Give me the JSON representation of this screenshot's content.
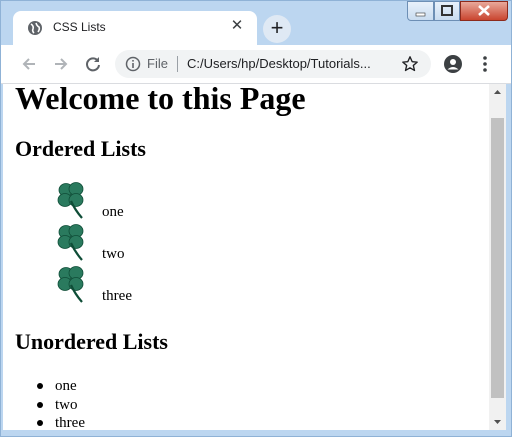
{
  "tab": {
    "title": "CSS Lists"
  },
  "address_bar": {
    "scheme_label": "File",
    "url": "C:/Users/hp/Desktop/Tutorials..."
  },
  "page": {
    "heading": "Welcome to this Page",
    "ordered_heading": "Ordered Lists",
    "ordered_items": [
      "one",
      "two",
      "three"
    ],
    "unordered_heading": "Unordered Lists",
    "unordered_items": [
      "one",
      "two",
      "three"
    ]
  },
  "icons": {
    "favicon": "globe-icon",
    "close_tab": "close-icon",
    "new_tab": "plus-icon",
    "back": "arrow-left-icon",
    "forward": "arrow-right-icon",
    "reload": "reload-icon",
    "info": "info-icon",
    "bookmark": "star-icon",
    "profile": "account-icon",
    "menu": "kebab-menu-icon",
    "list_marker": "four-leaf-clover-icon"
  },
  "colors": {
    "frame": "#bcd6f0",
    "clover": "#2a7a5e",
    "close_button": "#c9452f"
  }
}
